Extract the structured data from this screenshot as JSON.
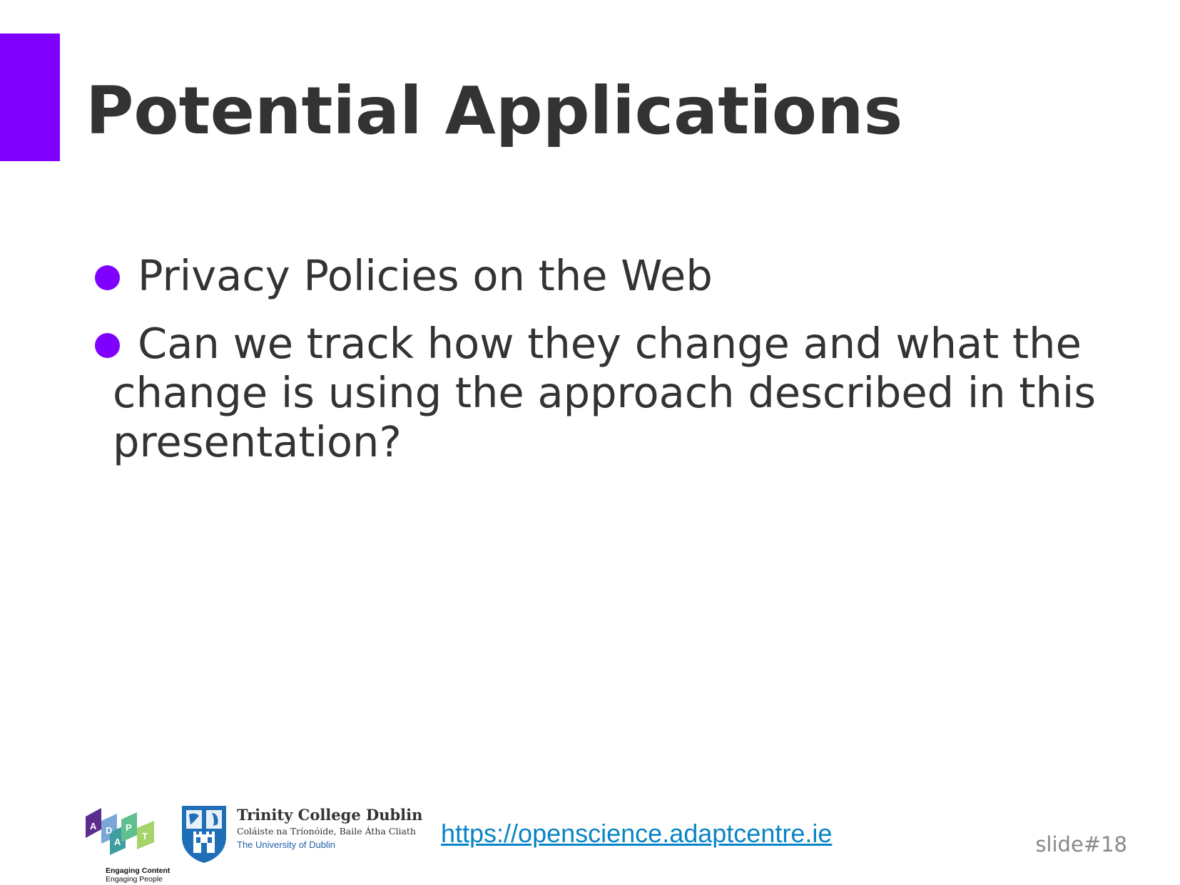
{
  "slide": {
    "title": "Potential Applications",
    "accent_color": "#7f00ff",
    "bullets": [
      "Privacy Policies on the Web",
      "Can we track how they change and what the change is using the approach described in this presentation?"
    ]
  },
  "footer": {
    "adapt_logo": {
      "letters": [
        "A",
        "D",
        "A",
        "P",
        "T"
      ],
      "caption_line1": "Engaging Content",
      "caption_line2": "Engaging People"
    },
    "tcd_logo": {
      "name": "Trinity College Dublin",
      "irish_name": "Coláiste na Tríonóide, Baile Átha Cliath",
      "university": "The University of Dublin"
    },
    "link": "https://openscience.adaptcentre.ie",
    "slide_number": "slide#18"
  }
}
